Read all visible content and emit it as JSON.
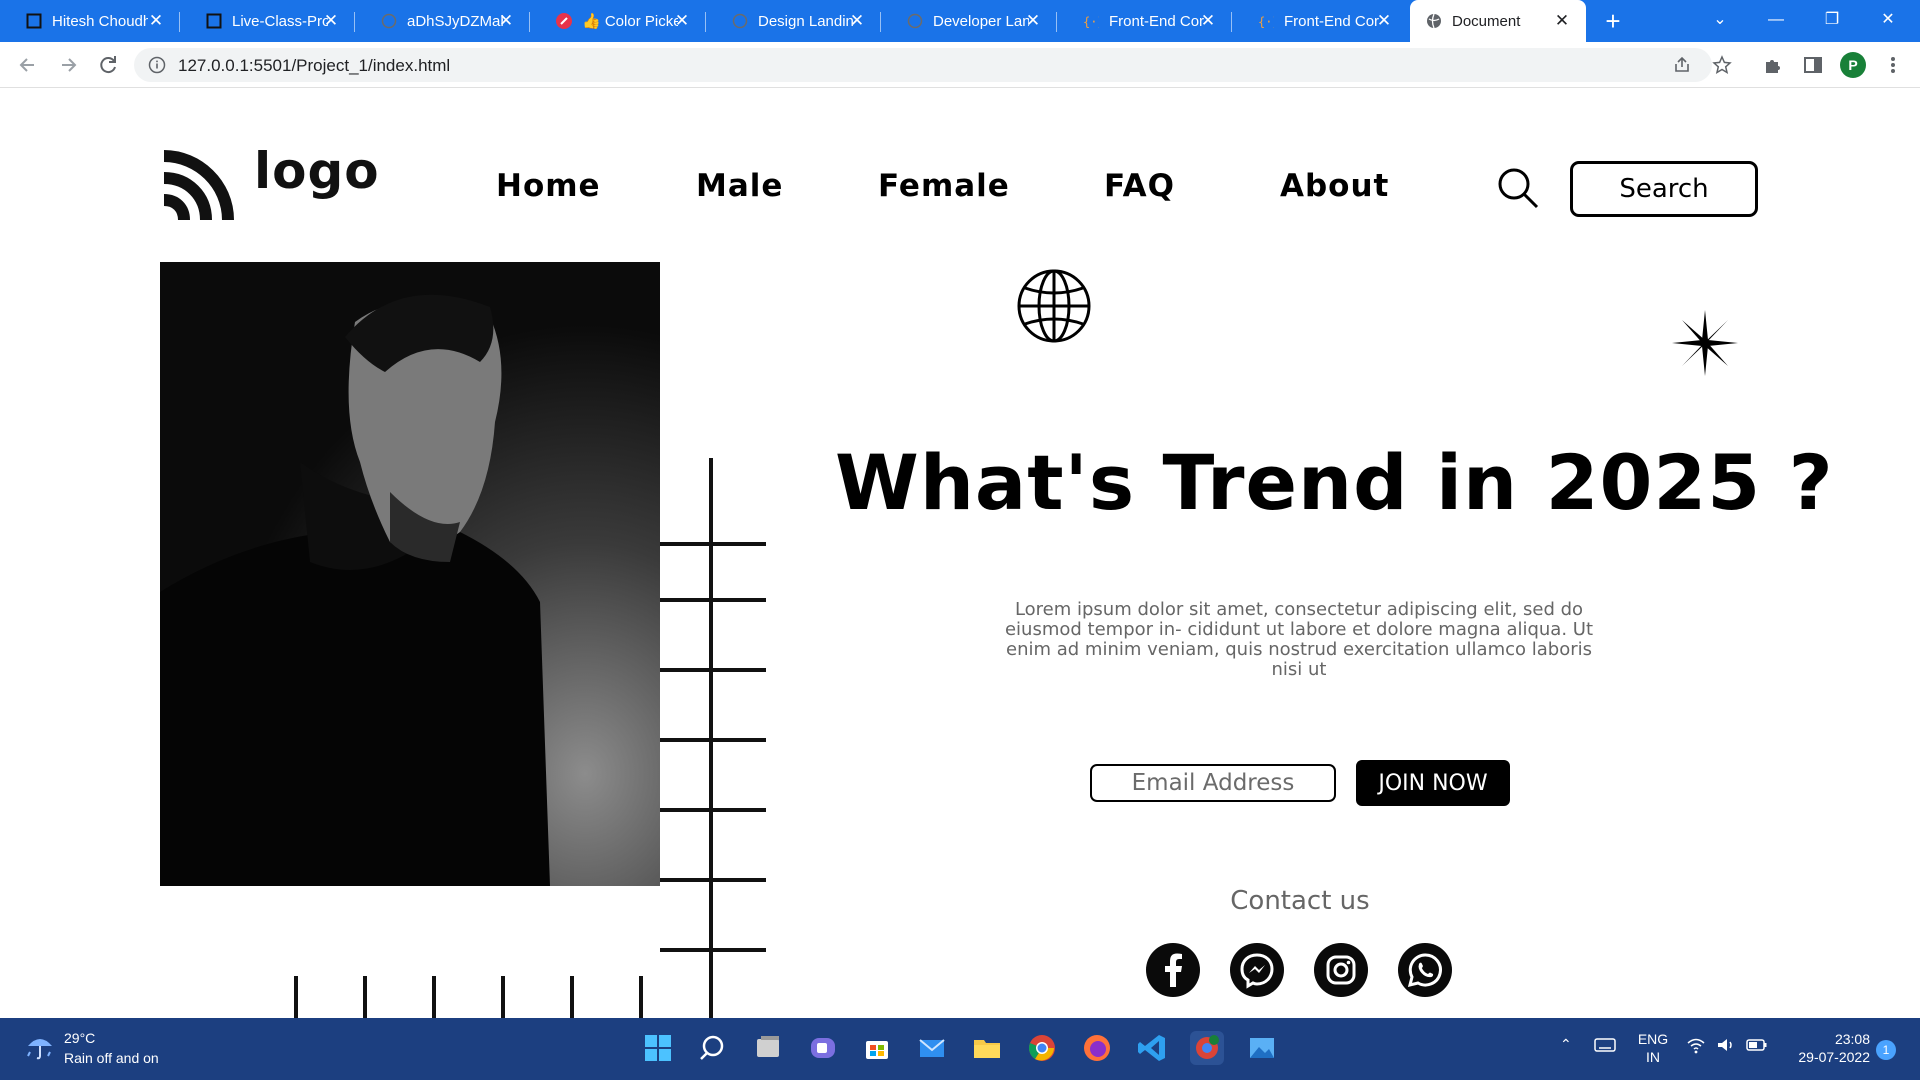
{
  "browser": {
    "tabs": [
      {
        "title": "Hitesh Choudh"
      },
      {
        "title": "Live-Class-Pro"
      },
      {
        "title": "aDhSJyDZMah"
      },
      {
        "title": "👍 Color Picke"
      },
      {
        "title": "Design Landin"
      },
      {
        "title": "Developer Lan"
      },
      {
        "title": "Front-End Cor"
      },
      {
        "title": "Front-End Cor"
      },
      {
        "title": "Document"
      }
    ],
    "active_tab_index": 8,
    "url": "127.0.0.1:5501/Project_1/index.html",
    "profile_initial": "P"
  },
  "page": {
    "logo_text": "logo",
    "nav": [
      "Home",
      "Male",
      "Female",
      "FAQ",
      "About"
    ],
    "search_label": "Search",
    "hero_title": "What's Trend in 2025 ?",
    "hero_text": "Lorem ipsum dolor sit amet, consectetur adipiscing elit, sed do eiusmod tempor in- cididunt ut labore et dolore magna aliqua. Ut enim ad minim veniam, quis nostrud exercitation ullamco laboris nisi ut",
    "email_placeholder": "Email Address",
    "join_label": "JOIN NOW",
    "contact_label": "Contact us",
    "socials": [
      "facebook-icon",
      "messenger-icon",
      "instagram-icon",
      "whatsapp-icon"
    ]
  },
  "taskbar": {
    "weather_temp": "29°C",
    "weather_desc": "Rain off and on",
    "lang_line1": "ENG",
    "lang_line2": "IN",
    "time": "23:08",
    "date": "29-07-2022",
    "notifications": "1"
  },
  "colors": {
    "chrome_blue": "#1a73e8",
    "taskbar": "#1c3f80",
    "text_primary": "#000000",
    "text_muted": "#666666"
  }
}
